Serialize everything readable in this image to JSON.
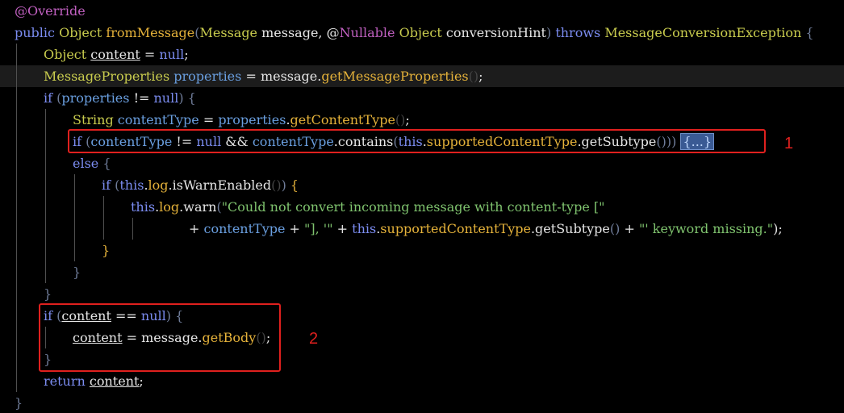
{
  "editor": {
    "lines": [
      [
        {
          "t": "@Override",
          "c": "an"
        }
      ],
      [
        {
          "t": "public ",
          "c": "kw"
        },
        {
          "t": "Object ",
          "c": "ty"
        },
        {
          "t": "fromMessage",
          "c": "fn"
        },
        {
          "t": "(",
          "c": "pr"
        },
        {
          "t": "Message ",
          "c": "ty"
        },
        {
          "t": "message, ",
          "c": "vr"
        },
        {
          "t": "@",
          "c": "vr"
        },
        {
          "t": "Nullable ",
          "c": "an"
        },
        {
          "t": "Object ",
          "c": "ty"
        },
        {
          "t": "conversionHint",
          "c": "vr"
        },
        {
          "t": ") ",
          "c": "pr"
        },
        {
          "t": "throws ",
          "c": "kw"
        },
        {
          "t": "MessageConversionException ",
          "c": "ty"
        },
        {
          "t": "{",
          "c": "pr"
        }
      ],
      [
        {
          "t": "Object ",
          "c": "ty"
        },
        {
          "t": "content",
          "c": "vu"
        },
        {
          "t": " = ",
          "c": "op"
        },
        {
          "t": "null",
          "c": "kw"
        },
        {
          "t": ";",
          "c": "op"
        }
      ],
      [
        {
          "t": "MessageProperties ",
          "c": "ty"
        },
        {
          "t": "properties",
          "c": "fd"
        },
        {
          "t": " = ",
          "c": "op"
        },
        {
          "t": "message",
          "c": "vr"
        },
        {
          "t": ".",
          "c": "op"
        },
        {
          "t": "getMessageProperties",
          "c": "fn"
        },
        {
          "t": "()",
          "c": "dim"
        },
        {
          "t": ";",
          "c": "op"
        }
      ],
      [
        {
          "t": "if ",
          "c": "kw"
        },
        {
          "t": "(",
          "c": "pr"
        },
        {
          "t": "properties",
          "c": "fd"
        },
        {
          "t": " != ",
          "c": "op"
        },
        {
          "t": "null",
          "c": "kw"
        },
        {
          "t": ") ",
          "c": "pr"
        },
        {
          "t": "{",
          "c": "pr"
        }
      ],
      [
        {
          "t": "String ",
          "c": "ty"
        },
        {
          "t": "contentType",
          "c": "fd"
        },
        {
          "t": " = ",
          "c": "op"
        },
        {
          "t": "properties",
          "c": "fd"
        },
        {
          "t": ".",
          "c": "op"
        },
        {
          "t": "getContentType",
          "c": "fn"
        },
        {
          "t": "()",
          "c": "dim"
        },
        {
          "t": ";",
          "c": "op"
        }
      ],
      [
        {
          "t": "if ",
          "c": "kw"
        },
        {
          "t": "(",
          "c": "pr"
        },
        {
          "t": "contentType",
          "c": "fd"
        },
        {
          "t": " != ",
          "c": "op"
        },
        {
          "t": "null",
          "c": "kw"
        },
        {
          "t": " && ",
          "c": "op"
        },
        {
          "t": "contentType",
          "c": "fd"
        },
        {
          "t": ".",
          "c": "op"
        },
        {
          "t": "contains",
          "c": "vr"
        },
        {
          "t": "(",
          "c": "pr"
        },
        {
          "t": "this",
          "c": "kw"
        },
        {
          "t": ".",
          "c": "op"
        },
        {
          "t": "supportedContentType",
          "c": "fn"
        },
        {
          "t": ".",
          "c": "op"
        },
        {
          "t": "getSubtype",
          "c": "vr"
        },
        {
          "t": "())) ",
          "c": "pr"
        },
        {
          "t": "{...}",
          "c": "fold"
        }
      ],
      [
        {
          "t": "else ",
          "c": "kw"
        },
        {
          "t": "{",
          "c": "pr"
        }
      ],
      [
        {
          "t": "if ",
          "c": "kw"
        },
        {
          "t": "(",
          "c": "pr"
        },
        {
          "t": "this",
          "c": "kw"
        },
        {
          "t": ".",
          "c": "op"
        },
        {
          "t": "log",
          "c": "fn"
        },
        {
          "t": ".",
          "c": "op"
        },
        {
          "t": "isWarnEnabled",
          "c": "vr"
        },
        {
          "t": "()",
          "c": "dim"
        },
        {
          "t": ") ",
          "c": "pr"
        },
        {
          "t": "{",
          "c": "fn"
        }
      ],
      [
        {
          "t": "this",
          "c": "kw"
        },
        {
          "t": ".",
          "c": "op"
        },
        {
          "t": "log",
          "c": "fn"
        },
        {
          "t": ".",
          "c": "op"
        },
        {
          "t": "warn",
          "c": "vr"
        },
        {
          "t": "(",
          "c": "pr"
        },
        {
          "t": "\"Could not convert incoming message with content-type [\"",
          "c": "st"
        }
      ],
      [
        {
          "t": "+ ",
          "c": "op"
        },
        {
          "t": "contentType",
          "c": "fd"
        },
        {
          "t": " + ",
          "c": "op"
        },
        {
          "t": "\"], '\"",
          "c": "st"
        },
        {
          "t": " + ",
          "c": "op"
        },
        {
          "t": "this",
          "c": "kw"
        },
        {
          "t": ".",
          "c": "op"
        },
        {
          "t": "supportedContentType",
          "c": "fn"
        },
        {
          "t": ".",
          "c": "op"
        },
        {
          "t": "getSubtype",
          "c": "vr"
        },
        {
          "t": "()",
          "c": "pr"
        },
        {
          "t": " + ",
          "c": "op"
        },
        {
          "t": "\"' keyword missing.\"",
          "c": "st"
        },
        {
          "t": ");",
          "c": "op"
        }
      ],
      [
        {
          "t": "}",
          "c": "fn"
        }
      ],
      [
        {
          "t": "}",
          "c": "pr"
        }
      ],
      [
        {
          "t": "}",
          "c": "pr"
        }
      ],
      [
        {
          "t": "if ",
          "c": "kw"
        },
        {
          "t": "(",
          "c": "pr"
        },
        {
          "t": "content",
          "c": "vu"
        },
        {
          "t": " == ",
          "c": "op"
        },
        {
          "t": "null",
          "c": "kw"
        },
        {
          "t": ") ",
          "c": "pr"
        },
        {
          "t": "{",
          "c": "pr"
        }
      ],
      [
        {
          "t": "content",
          "c": "vu"
        },
        {
          "t": " = ",
          "c": "op"
        },
        {
          "t": "message",
          "c": "vr"
        },
        {
          "t": ".",
          "c": "op"
        },
        {
          "t": "getBody",
          "c": "fn"
        },
        {
          "t": "()",
          "c": "dim"
        },
        {
          "t": ";",
          "c": "op"
        }
      ],
      [
        {
          "t": "}",
          "c": "pr"
        }
      ],
      [
        {
          "t": "return ",
          "c": "kw"
        },
        {
          "t": "content",
          "c": "vu"
        },
        {
          "t": ";",
          "c": "op"
        }
      ],
      [
        {
          "t": "}",
          "c": "pr"
        }
      ]
    ]
  },
  "annotations": {
    "marker_1": "1",
    "marker_2": "2"
  },
  "colors": {
    "background": "#000000",
    "annotation_red": "#e0201e",
    "keyword": "#7b8cf0",
    "type": "#c9cc4e",
    "method": "#e5b23a",
    "string": "#7fc36e",
    "annotation": "#c060c0"
  }
}
